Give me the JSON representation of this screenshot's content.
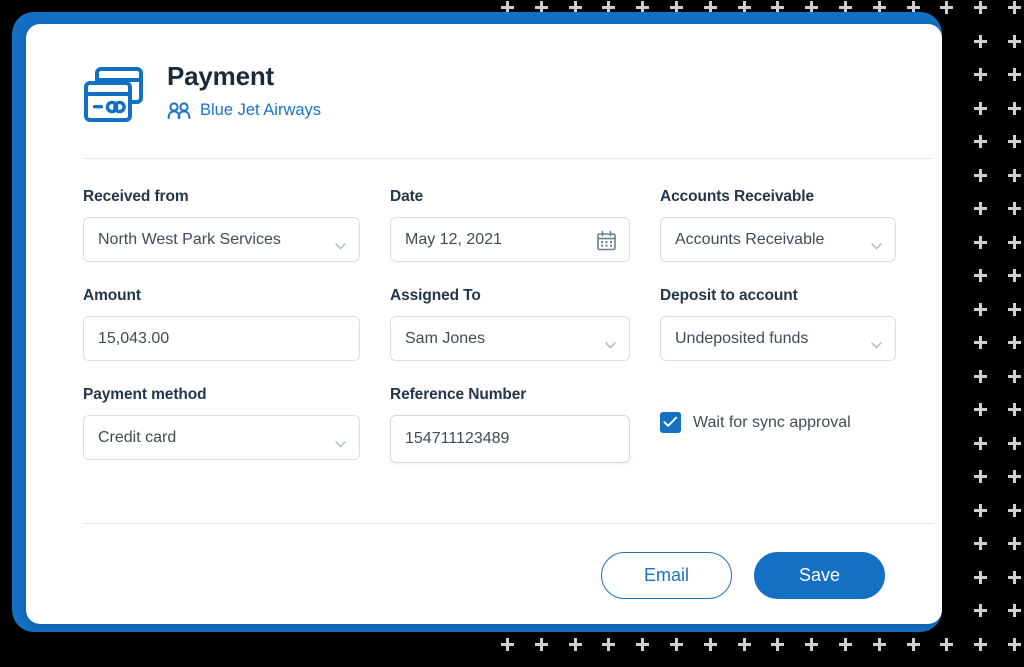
{
  "window": {
    "accent_color": "#1470c4",
    "link_color": "#1a73c7",
    "background_color": "#000000",
    "card_background": "#ffffff"
  },
  "header": {
    "icon": "credit-cards-icon",
    "title": "Payment",
    "subtitle_icon": "people-icon",
    "subtitle": "Blue Jet Airways"
  },
  "form": {
    "rows": [
      {
        "fields": [
          {
            "label": "Received from",
            "value": "North West Park Services",
            "type": "select",
            "icon": "chevron-down-icon"
          },
          {
            "label": "Date",
            "value": "May 12, 2021",
            "type": "date",
            "icon": "calendar-icon"
          },
          {
            "label": "Accounts Receivable",
            "value": "Accounts Receivable",
            "type": "select",
            "icon": "chevron-down-icon"
          }
        ]
      },
      {
        "fields": [
          {
            "label": "Amount",
            "value": "15,043.00",
            "type": "text",
            "icon": ""
          },
          {
            "label": "Assigned To",
            "value": "Sam Jones",
            "type": "select",
            "icon": "chevron-down-icon"
          },
          {
            "label": "Deposit to account",
            "value": "Undeposited funds",
            "type": "select",
            "icon": "chevron-down-icon"
          }
        ]
      },
      {
        "fields": [
          {
            "label": "Payment method",
            "value": "Credit card",
            "type": "select",
            "icon": "chevron-down-icon"
          },
          {
            "label": "Reference Number",
            "value": "154711123489",
            "type": "text",
            "icon": ""
          }
        ]
      }
    ],
    "checkbox": {
      "label": "Wait for sync approval",
      "checked": true,
      "color": "#1470c4"
    }
  },
  "footer": {
    "email_label": "Email",
    "save_label": "Save"
  }
}
